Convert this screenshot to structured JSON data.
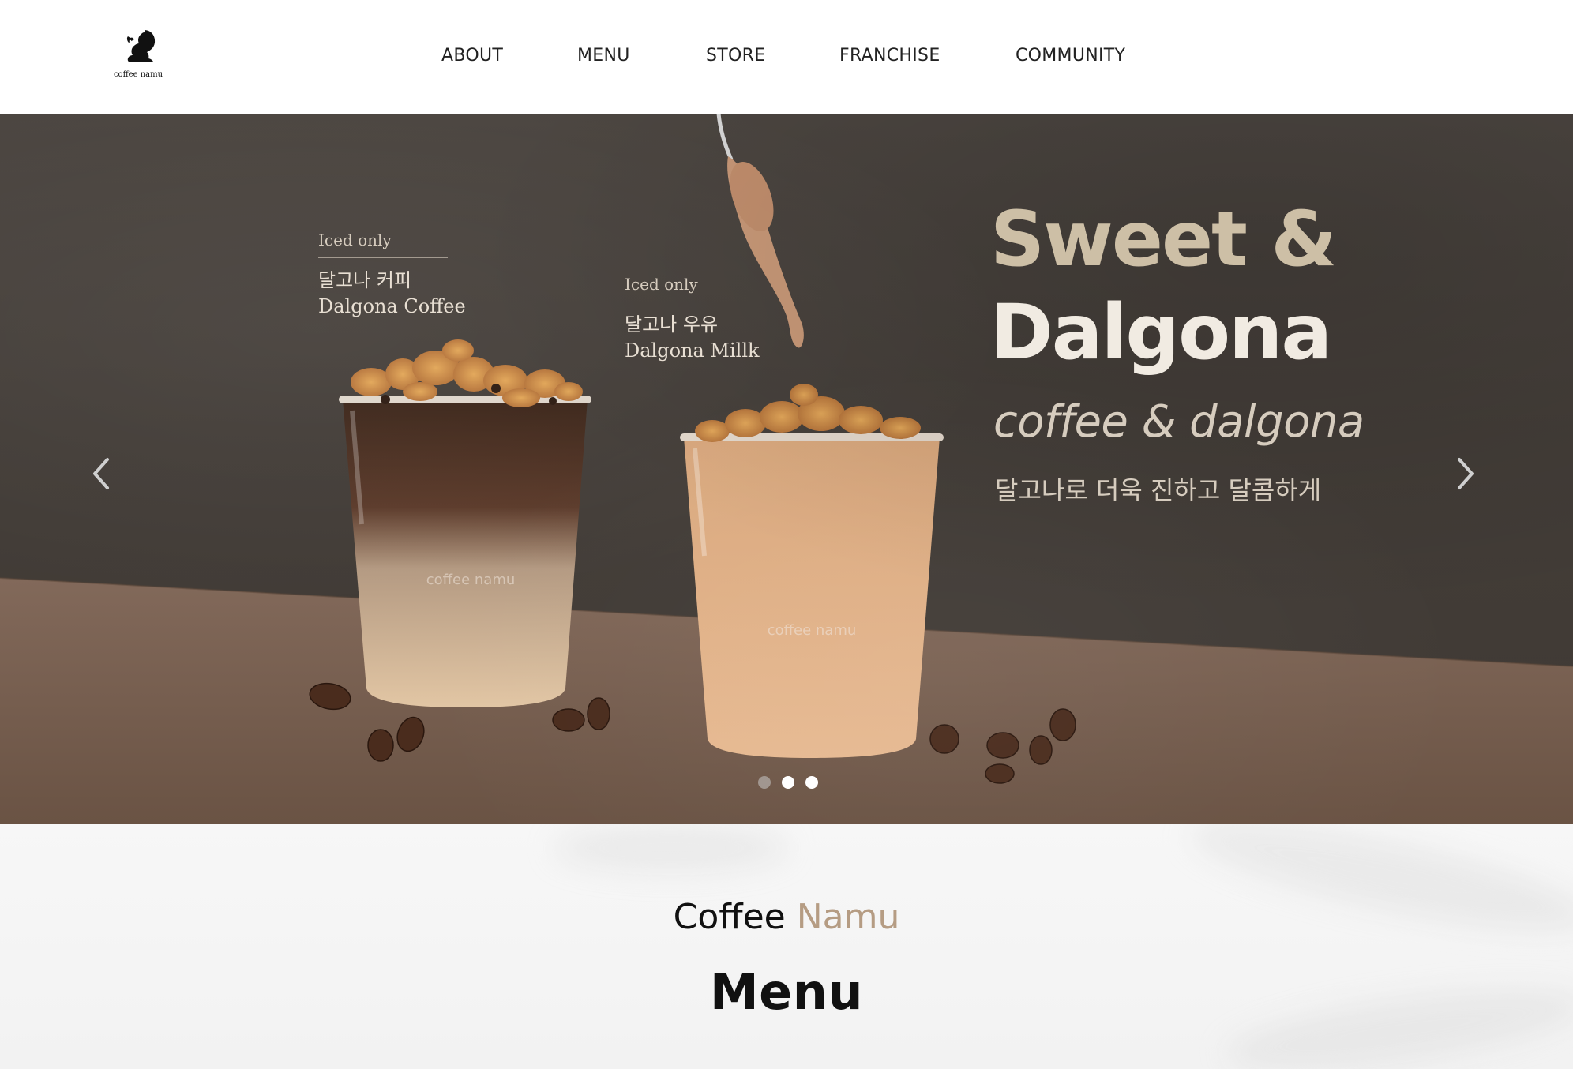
{
  "brand": {
    "logo_text": "coffee namu"
  },
  "nav": {
    "items": [
      {
        "label": "ABOUT"
      },
      {
        "label": "MENU"
      },
      {
        "label": "STORE"
      },
      {
        "label": "FRANCHISE"
      },
      {
        "label": "COMMUNITY"
      }
    ]
  },
  "hero": {
    "products": [
      {
        "badge": "Iced only",
        "name_ko": "달고나 커피",
        "name_en": "Dalgona Coffee"
      },
      {
        "badge": "Iced only",
        "name_ko": "달고나 우유",
        "name_en": "Dalgona Millk"
      }
    ],
    "cup_print": "coffee namu",
    "title_line1": "Sweet &",
    "title_line2": "Dalgona",
    "subtitle": "coffee & dalgona",
    "tagline_ko": "달고나로 더욱 진하고 달콤하게",
    "prev_icon": "chevron-left-icon",
    "next_icon": "chevron-right-icon",
    "slides_total": 3,
    "active_slide": 1
  },
  "menu_section": {
    "subtitle_a": "Coffee",
    "subtitle_b": "Namu",
    "title": "Menu"
  },
  "colors": {
    "accent": "#b59c83",
    "hero_bg": "#45403b",
    "hero_floor": "#7a6250",
    "title_tan": "#cdbfa6"
  }
}
